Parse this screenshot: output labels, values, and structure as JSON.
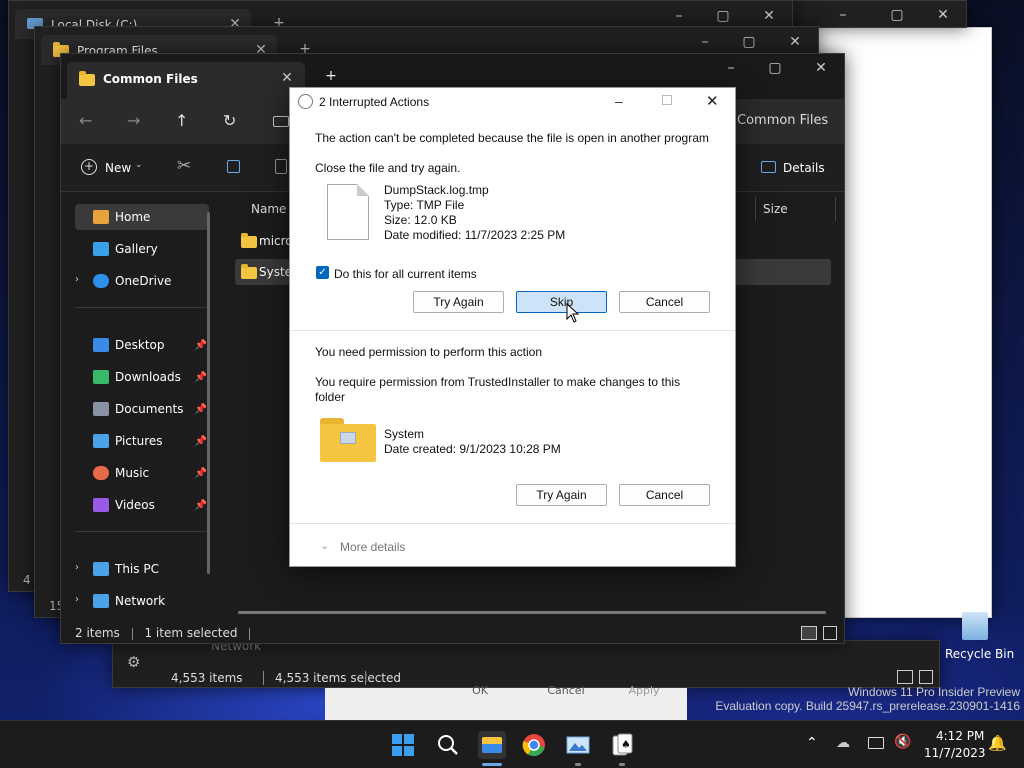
{
  "windows": {
    "back1_title": "Local Disk (C:)",
    "back2_title": "Program Files",
    "back1_status_items": "4,553 items",
    "back1_status_selected": "4,553 items selected",
    "back1_footer_fragment_1": "4 i",
    "back1_footer_fragment_2": "15",
    "network_label_back": "Network",
    "back_ok": "OK",
    "back_cancel": "Cancel",
    "back_apply": "Apply"
  },
  "explorer": {
    "tab_title": "Common Files",
    "new_tab": "+",
    "new_label": "New",
    "details_label": "Details",
    "breadcrumb_fragment": "Common Files",
    "col_name": "Name",
    "col_size": "Size",
    "files": [
      {
        "name": "micro"
      },
      {
        "name": "Syster"
      }
    ],
    "sidebar": [
      {
        "label": "Home",
        "color": "#e8a23a"
      },
      {
        "label": "Gallery",
        "color": "#3aa0e8"
      },
      {
        "label": "OneDrive",
        "color": "#2d8fe8"
      },
      {
        "label": "Desktop",
        "color": "#3a8be8"
      },
      {
        "label": "Downloads",
        "color": "#3ab86a"
      },
      {
        "label": "Documents",
        "color": "#8a93a3"
      },
      {
        "label": "Pictures",
        "color": "#4aa3e8"
      },
      {
        "label": "Music",
        "color": "#e86a4a"
      },
      {
        "label": "Videos",
        "color": "#9a5ae8"
      },
      {
        "label": "This PC",
        "color": "#4aa3e8"
      },
      {
        "label": "Network",
        "color": "#4aa3e8"
      }
    ],
    "status_items": "2 items",
    "status_selected": "1 item selected"
  },
  "dialog": {
    "title": "2 Interrupted Actions",
    "msg1": "The action can't be completed because the file is open in another program",
    "msg2": "Close the file and try again.",
    "file_name": "DumpStack.log.tmp",
    "file_type": "Type: TMP File",
    "file_size": "Size: 12.0 KB",
    "file_modified": "Date modified: 11/7/2023 2:25 PM",
    "checkbox_label": "Do this for all current items",
    "btn_try_again": "Try Again",
    "btn_skip": "Skip",
    "btn_cancel": "Cancel",
    "perm_title": "You need permission to perform this action",
    "perm_line1": "You require permission from TrustedInstaller to make changes to this",
    "perm_line2": "folder",
    "folder_name": "System",
    "folder_created": "Date created: 9/1/2023 10:28 PM",
    "btn_try_again_2": "Try Again",
    "btn_cancel_2": "Cancel",
    "more_details": "More details"
  },
  "desktop": {
    "recycle_bin": "Recycle Bin",
    "watermark_line1": "Windows 11 Pro Insider Preview",
    "watermark_line2": "Evaluation copy. Build 25947.rs_prerelease.230901-1416"
  },
  "taskbar": {
    "time": "4:12 PM",
    "date": "11/7/2023"
  }
}
